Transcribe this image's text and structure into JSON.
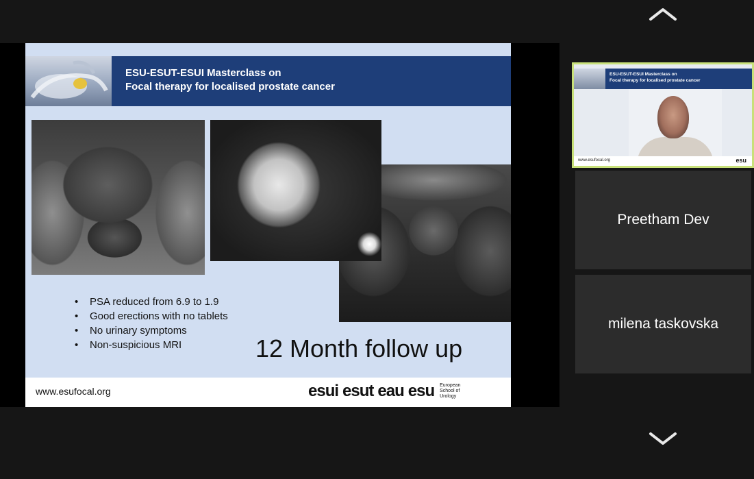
{
  "controls": {
    "scroll_up_icon": "chevron-up-icon",
    "scroll_down_icon": "chevron-down-icon"
  },
  "shared_slide": {
    "banner_title_line1": "ESU-ESUT-ESUI Masterclass on",
    "banner_title_line2": "Focal therapy for localised prostate cancer",
    "bullets": [
      "PSA reduced from 6.9 to 1.9",
      "Good erections with no tablets",
      "No urinary  symptoms",
      "Non-suspicious MRI"
    ],
    "headline": "12  Month follow up",
    "footer_url": "www.esufocal.org",
    "footer_logos": [
      "esui",
      "esut",
      "eau",
      "esu"
    ],
    "footer_small_lines": [
      "European",
      "School of",
      "Urology"
    ],
    "colors": {
      "banner": "#1e3e79",
      "slide_bg": "#d1def2"
    }
  },
  "participants": {
    "active_thumbnail": {
      "banner_line1": "ESU-ESUT-ESUI Masterclass on",
      "banner_line2": "Focal therapy for localised prostate cancer",
      "footer_url": "www.esufocal.org",
      "footer_logo": "esu",
      "highlight_color": "#c8e07a"
    },
    "tiles": [
      {
        "name": "Preetham Dev"
      },
      {
        "name": "milena taskovska"
      }
    ]
  }
}
